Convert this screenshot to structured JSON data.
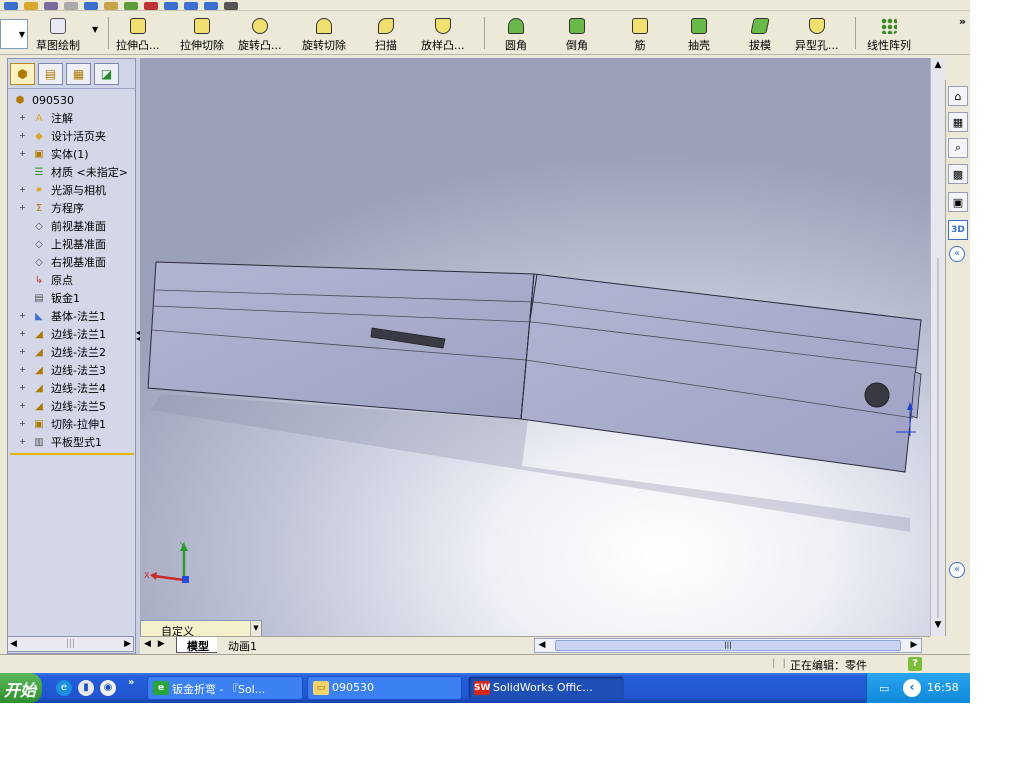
{
  "toolbar": {
    "items": [
      {
        "label": "草图绘制",
        "icon": "sketch-icon"
      },
      {
        "label": "拉伸凸...",
        "icon": "extruded-boss-icon"
      },
      {
        "label": "拉伸切除",
        "icon": "extruded-cut-icon"
      },
      {
        "label": "旋转凸...",
        "icon": "revolved-boss-icon"
      },
      {
        "label": "旋转切除",
        "icon": "revolved-cut-icon"
      },
      {
        "label": "扫描",
        "icon": "sweep-icon"
      },
      {
        "label": "放样凸...",
        "icon": "loft-icon"
      },
      {
        "label": "圆角",
        "icon": "fillet-icon"
      },
      {
        "label": "倒角",
        "icon": "chamfer-icon"
      },
      {
        "label": "筋",
        "icon": "rib-icon"
      },
      {
        "label": "抽壳",
        "icon": "shell-icon"
      },
      {
        "label": "拔模",
        "icon": "draft-icon"
      },
      {
        "label": "异型孔...",
        "icon": "hole-wizard-icon"
      },
      {
        "label": "线性阵列",
        "icon": "linear-pattern-icon"
      }
    ],
    "overflow": "»"
  },
  "tree": {
    "root": "090530",
    "items": [
      {
        "label": "注解",
        "icon": "annotations-icon",
        "expandable": true
      },
      {
        "label": "设计活页夹",
        "icon": "design-binder-icon",
        "expandable": true
      },
      {
        "label": "实体(1)",
        "icon": "solid-bodies-icon",
        "expandable": true
      },
      {
        "label": "材质 <未指定>",
        "icon": "material-icon",
        "expandable": false
      },
      {
        "label": "光源与相机",
        "icon": "lights-cameras-icon",
        "expandable": true
      },
      {
        "label": "方程序",
        "icon": "equations-icon",
        "expandable": true
      },
      {
        "label": "前视基准面",
        "icon": "plane-icon",
        "expandable": false
      },
      {
        "label": "上视基准面",
        "icon": "plane-icon",
        "expandable": false
      },
      {
        "label": "右视基准面",
        "icon": "plane-icon",
        "expandable": false
      },
      {
        "label": "原点",
        "icon": "origin-icon",
        "expandable": false
      },
      {
        "label": "钣金1",
        "icon": "sheet-metal-icon",
        "expandable": false
      },
      {
        "label": "基体-法兰1",
        "icon": "base-flange-icon",
        "expandable": true
      },
      {
        "label": "边线-法兰1",
        "icon": "edge-flange-icon",
        "expandable": true
      },
      {
        "label": "边线-法兰2",
        "icon": "edge-flange-icon",
        "expandable": true
      },
      {
        "label": "边线-法兰3",
        "icon": "edge-flange-icon",
        "expandable": true
      },
      {
        "label": "边线-法兰4",
        "icon": "edge-flange-icon",
        "expandable": true
      },
      {
        "label": "边线-法兰5",
        "icon": "edge-flange-icon",
        "expandable": true
      },
      {
        "label": "切除-拉伸1",
        "icon": "cut-extrude-icon",
        "expandable": true
      },
      {
        "label": "平板型式1",
        "icon": "flat-pattern-icon",
        "expandable": true
      }
    ]
  },
  "viewport": {
    "config": "自定义",
    "tabs": [
      "模型",
      "动画1"
    ],
    "triad": {
      "x": "X",
      "y": "Y"
    },
    "colors": {
      "part_face": "#a8abcc",
      "part_edge": "#2a2a3a",
      "hole": "#3a3a44",
      "slot": "#3a3a44"
    }
  },
  "status": {
    "mode": "正在编辑：零件",
    "help": "?"
  },
  "taskpane": {
    "buttons": [
      "home-icon",
      "resources-icon",
      "search-icon",
      "library-icon",
      "appearance-icon",
      "3dcontent-icon"
    ],
    "active_label": "3D"
  },
  "taskbar": {
    "start": "开始",
    "quick_more": "»",
    "tasks": [
      {
        "label": "钣金折弯 - 『Sol...",
        "icon": "ie-icon"
      },
      {
        "label": "090530",
        "icon": "folder-icon"
      },
      {
        "label": "SolidWorks Offic...",
        "icon": "solidworks-icon"
      }
    ],
    "clock": "16:58"
  }
}
